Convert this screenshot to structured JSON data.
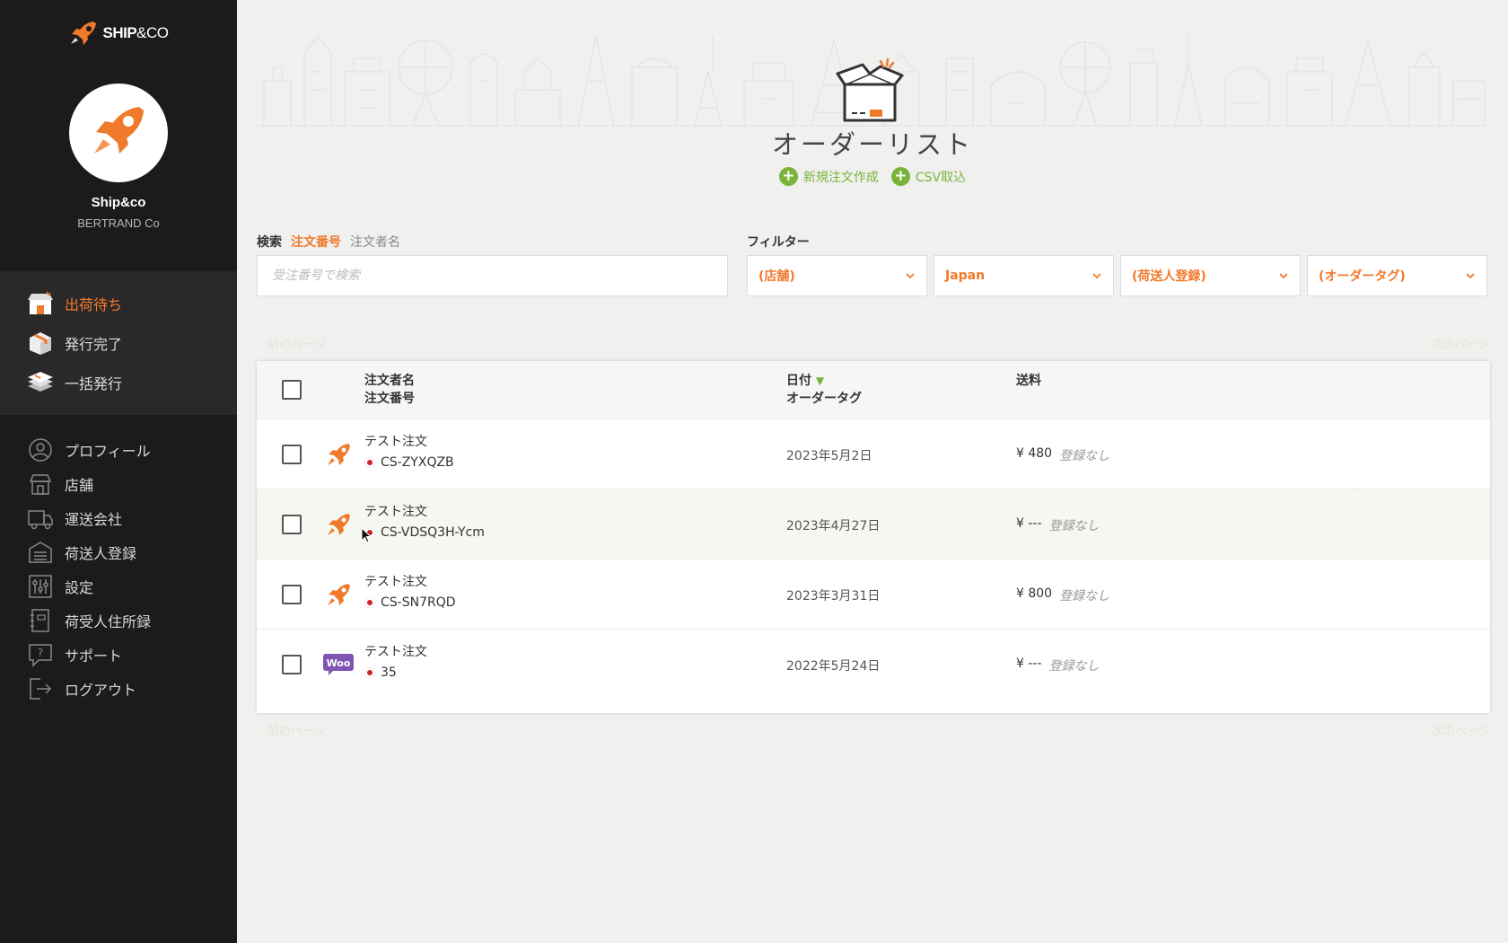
{
  "sidebar": {
    "logo": {
      "bold": "SHIP",
      "light": "&CO"
    },
    "shop_name": "Ship&co",
    "shop_sub": "BERTRAND Co",
    "primary": [
      {
        "label": "出荷待ち",
        "icon": "store-icon",
        "active": true
      },
      {
        "label": "発行完了",
        "icon": "box-icon",
        "active": false
      },
      {
        "label": "一括発行",
        "icon": "stack-icon",
        "active": false
      }
    ],
    "secondary": [
      {
        "label": "プロフィール",
        "icon": "user-icon"
      },
      {
        "label": "店舗",
        "icon": "shop-icon"
      },
      {
        "label": "運送会社",
        "icon": "truck-icon"
      },
      {
        "label": "荷送人登録",
        "icon": "warehouse-icon"
      },
      {
        "label": "設定",
        "icon": "sliders-icon"
      },
      {
        "label": "荷受人住所録",
        "icon": "address-book-icon"
      },
      {
        "label": "サポート",
        "icon": "help-icon"
      },
      {
        "label": "ログアウト",
        "icon": "logout-icon"
      }
    ]
  },
  "header": {
    "title": "オーダーリスト",
    "actions": {
      "new_order": "新規注文作成",
      "csv_import": "CSV取込"
    }
  },
  "search": {
    "label": "検索",
    "tab_active": "注文番号",
    "tab_other": "注文者名",
    "placeholder": "受注番号で検索"
  },
  "filter": {
    "label": "フィルター",
    "selects": [
      "(店舗)",
      "Japan",
      "(荷送人登録)",
      "(オーダータグ)"
    ]
  },
  "pager": {
    "prev": "前のページ",
    "next": "次のページ"
  },
  "table": {
    "headers": {
      "customer": "注文者名",
      "order_no": "注文番号",
      "date": "日付",
      "tag": "オーダータグ",
      "fee": "送料"
    },
    "rows": [
      {
        "customer": "テスト注文",
        "order_no": "CS-ZYXQZB",
        "source": "rocket-icon",
        "date": "2023年5月2日",
        "fee": "¥ 480",
        "note": "登録なし"
      },
      {
        "customer": "テスト注文",
        "order_no": "CS-VDSQ3H-Ycm",
        "source": "rocket-icon",
        "date": "2023年4月27日",
        "fee": "¥ ---",
        "note": "登録なし"
      },
      {
        "customer": "テスト注文",
        "order_no": "CS-SN7RQD",
        "source": "rocket-icon",
        "date": "2023年3月31日",
        "fee": "¥ 800",
        "note": "登録なし"
      },
      {
        "customer": "テスト注文",
        "order_no": "35",
        "source": "woo-icon",
        "date": "2022年5月24日",
        "fee": "¥ ---",
        "note": "登録なし"
      }
    ]
  },
  "colors": {
    "accent": "#f07a2b",
    "green": "#7ab33a",
    "sidebar": "#1d1a1b"
  }
}
